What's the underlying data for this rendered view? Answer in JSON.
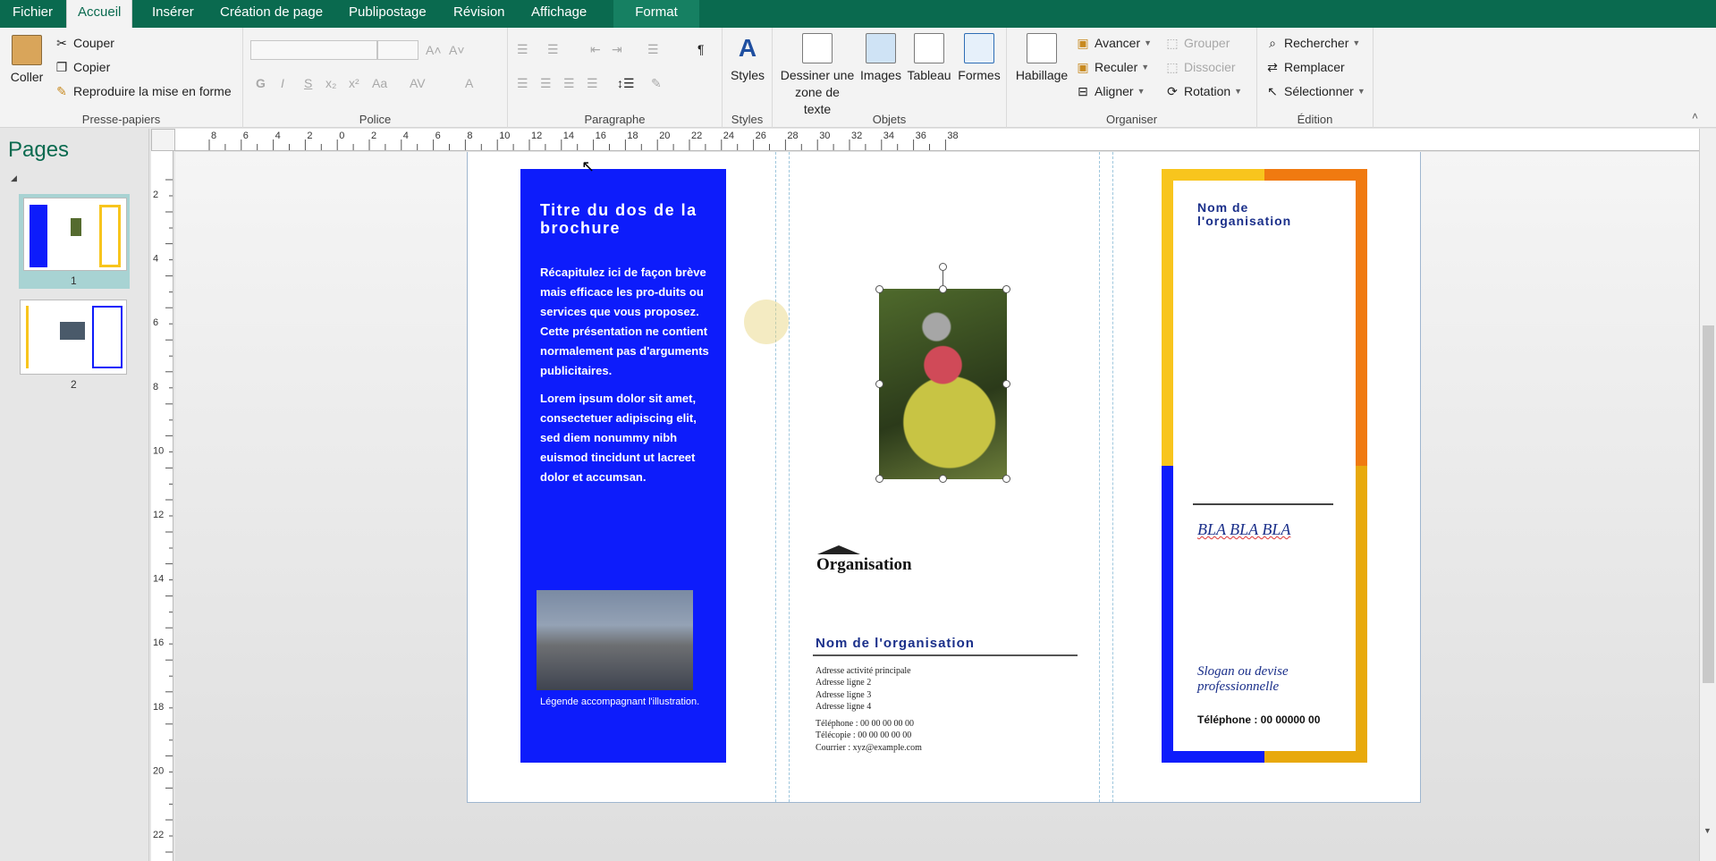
{
  "tabs": [
    "Fichier",
    "Accueil",
    "Insérer",
    "Création de page",
    "Publipostage",
    "Révision",
    "Affichage",
    "Format"
  ],
  "active_tab": "Accueil",
  "ribbon": {
    "clipboard": {
      "label": "Presse-papiers",
      "paste": "Coller",
      "cut": "Couper",
      "copy": "Copier",
      "format_painter": "Reproduire la mise en forme"
    },
    "font": {
      "label": "Police",
      "bold": "G",
      "italic": "I",
      "underline": "S",
      "subscript": "x₂",
      "superscript": "x²",
      "case": "Aa",
      "spacing": "AV",
      "color": "A",
      "grow": "A˄",
      "shrink": "A˅"
    },
    "paragraph": {
      "label": "Paragraphe",
      "pilcrow": "¶"
    },
    "styles": {
      "label": "Styles",
      "button": "Styles"
    },
    "objects": {
      "label": "Objets",
      "textbox": "Dessiner une zone de texte",
      "images": "Images",
      "table": "Tableau",
      "shapes": "Formes"
    },
    "arrange": {
      "label": "Organiser",
      "wrap": "Habillage",
      "forward": "Avancer",
      "backward": "Reculer",
      "align": "Aligner",
      "group": "Grouper",
      "ungroup": "Dissocier",
      "rotate": "Rotation"
    },
    "editing": {
      "label": "Édition",
      "find": "Rechercher",
      "replace": "Remplacer",
      "select": "Sélectionner"
    }
  },
  "pages_pane": {
    "title": "Pages",
    "pages": [
      "1",
      "2"
    ]
  },
  "ruler": {
    "h_ticks": [
      "8",
      "6",
      "4",
      "2",
      "0",
      "2",
      "4",
      "6",
      "8",
      "10",
      "12",
      "14",
      "16",
      "18",
      "20",
      "22",
      "24",
      "26",
      "28",
      "30",
      "32",
      "34",
      "36",
      "38"
    ],
    "v_ticks": [
      "2",
      "4",
      "6",
      "8",
      "10",
      "12",
      "14",
      "16",
      "18",
      "20",
      "22"
    ]
  },
  "document": {
    "back_title": "Titre du dos de la brochure",
    "back_para1": "Récapitulez ici de façon brève mais efficace les pro-duits ou services que vous proposez. Cette présentation ne contient normalement pas d'arguments publicitaires.",
    "back_para2": "Lorem ipsum dolor sit amet, consectetuer adipiscing elit, sed diem nonummy nibh euismod tincidunt ut lacreet dolor et accumsan.",
    "caption": "Légende accompagnant l'illustration.",
    "org_logo_text": "Organisation",
    "org_name": "Nom de l'organisation",
    "address_lines": [
      "Adresse activité principale",
      "Adresse ligne 2",
      "Adresse ligne 3",
      "Adresse ligne 4"
    ],
    "contact_lines": [
      "Téléphone : 00 00 00 00 00",
      "Télécopie : 00 00 00 00 00",
      "Courrier : xyz@example.com"
    ],
    "cover_org": "Nom de l'organisation",
    "cover_headline": "BLA BLA BLA",
    "slogan": "Slogan ou devise professionnelle",
    "cover_tel": "Téléphone : 00 00000 00"
  },
  "colors": {
    "ribbon_green": "#0a6a4f",
    "blue_panel": "#0d1cfb",
    "navy_text": "#1a2f8a",
    "frame_yellow": "#f8c51d",
    "frame_orange": "#f07a10"
  }
}
